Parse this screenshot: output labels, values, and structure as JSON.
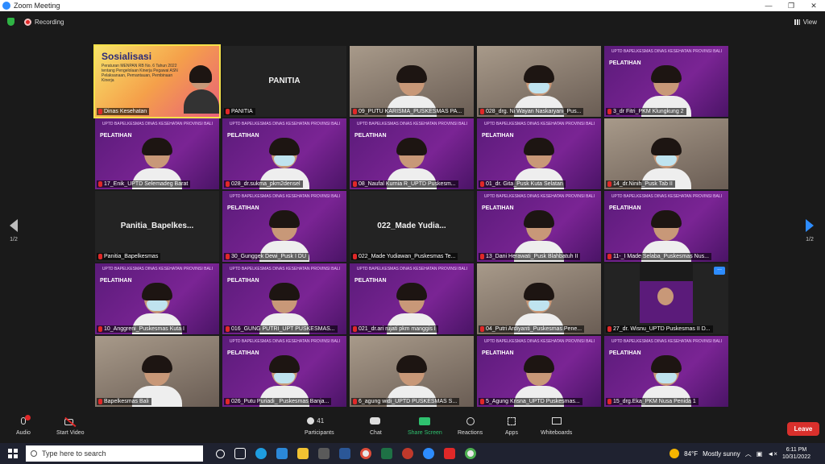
{
  "window": {
    "title": "Zoom Meeting"
  },
  "topbar": {
    "recording": "Recording",
    "view": "View"
  },
  "pager": {
    "left": "1/2",
    "right": "1/2"
  },
  "tiles": [
    {
      "kind": "sos",
      "label": "Dinas Kesehatan",
      "title": "Sosialisasi",
      "subtitle": "Peraturan MENPAN RB No. 6 Tahun 2022 tentang Pengelolaan Kinerja Pegawai ASN Pelaksanaan, Pemantauan, Pembinaan Kinerja",
      "active": true
    },
    {
      "kind": "name",
      "label": "PANITIA",
      "bigname": "PANITIA"
    },
    {
      "kind": "photo",
      "label": "09_PUTU KARISMA_PUSKESMAS PA..."
    },
    {
      "kind": "photo",
      "label": "028_drg. Ni Wayan Naskaryani_Pus..."
    },
    {
      "kind": "purple",
      "label": "3_dr Fitri_PKM Klungkung 2"
    },
    {
      "kind": "purple",
      "label": "17_Enik_UPTD Selemadeg Barat"
    },
    {
      "kind": "purple",
      "label": "028_dr.sukma_pkm2densel"
    },
    {
      "kind": "purple",
      "label": "08_Naufal Kurnia R_UPTD Puskesm..."
    },
    {
      "kind": "purple",
      "label": "01_dr. Gita_Pusk Kuta Selatan"
    },
    {
      "kind": "photo",
      "label": "14_dr.Ninih_Pusk Tab II"
    },
    {
      "kind": "name",
      "label": "Panitia_Bapelkesmas",
      "bigname": "Panitia_Bapelkes..."
    },
    {
      "kind": "purple",
      "label": "30_Gunggek Dewi_Pusk I DU"
    },
    {
      "kind": "name",
      "label": "022_Made Yudiawan_Puskesmas Te...",
      "bigname": "022_Made Yudia..."
    },
    {
      "kind": "purple",
      "label": "13_Dani Herawati_Pusk Blahbatuh II"
    },
    {
      "kind": "purple",
      "label": "11-_I Made Selaba_Puskesmas Nus..."
    },
    {
      "kind": "purple",
      "label": "10_Anggreni_Puskesmas Kuta I"
    },
    {
      "kind": "purple",
      "label": "016_GUNG PUTRI_UPT PUSKESMAS..."
    },
    {
      "kind": "purple",
      "label": "021_dr.ari rujati pkm manggis I"
    },
    {
      "kind": "photo",
      "label": "04_Putri Ardiyanti_Puskesmas Pene..."
    },
    {
      "kind": "small",
      "label": "27_dr. Wisnu_UPTD Puskesmas II D..."
    },
    {
      "kind": "photo",
      "label": "Bapelkesmas Bali"
    },
    {
      "kind": "purple",
      "label": "026_Putu Puriadi_ Puskesmas Banja..."
    },
    {
      "kind": "photo",
      "label": "6_agung widi_UPTD PUSKESMAS S..."
    },
    {
      "kind": "purple",
      "label": "5_Agung Krisna_UPTD Puskesmas..."
    },
    {
      "kind": "purple",
      "label": "15_drg.Eka_PKM Nusa Penida 1"
    }
  ],
  "banner": {
    "header": "UPTD BAPELKESMAS DINAS KESEHATAN PROVINSI BALI",
    "title": "PELATIHAN"
  },
  "toolbar": {
    "audio": "Audio",
    "video": "Start Video",
    "participants": "Participants",
    "participants_count": "41",
    "chat": "Chat",
    "share": "Share Screen",
    "reactions": "Reactions",
    "apps": "Apps",
    "whiteboards": "Whiteboards",
    "leave": "Leave"
  },
  "taskbar": {
    "search_placeholder": "Type here to search",
    "weather_temp": "84°F",
    "weather_desc": "Mostly sunny",
    "time": "6:11 PM",
    "date": "10/31/2022"
  }
}
